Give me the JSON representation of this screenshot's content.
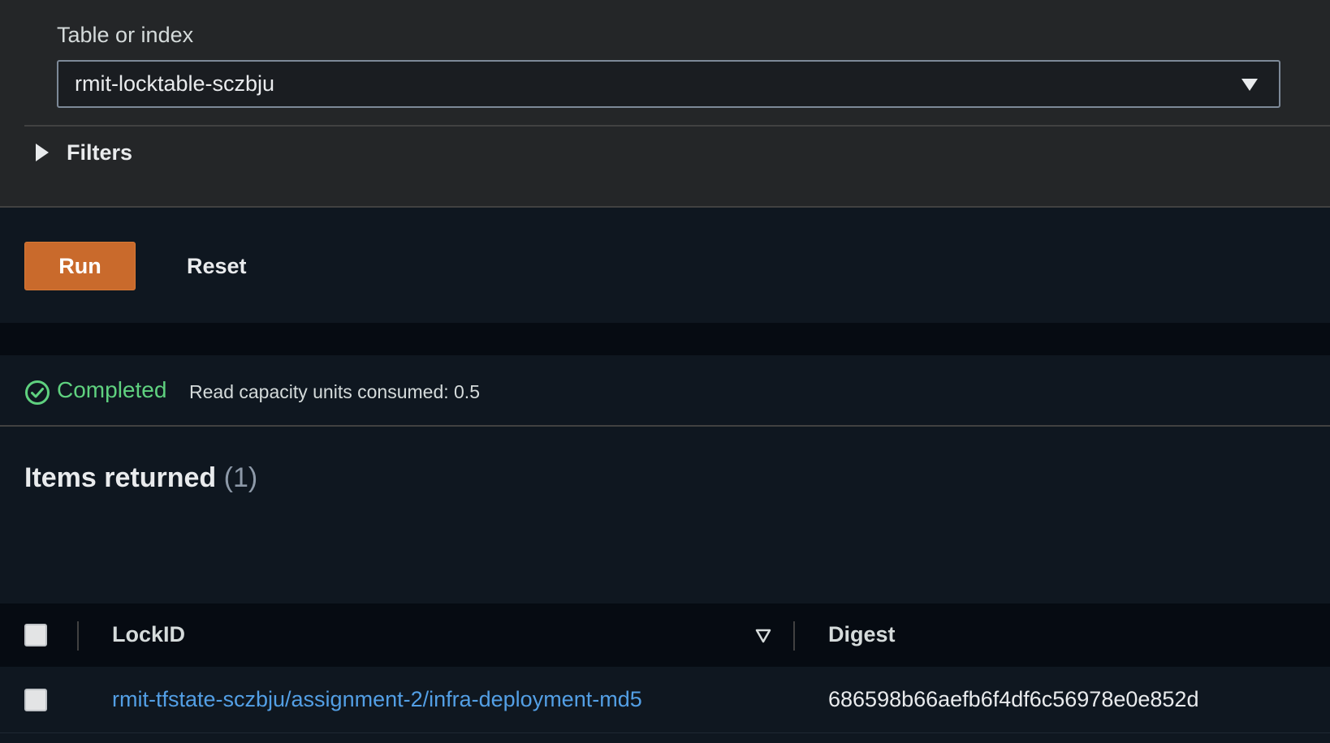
{
  "query_panel": {
    "table_label": "Table or index",
    "table_value": "rmit-locktable-sczbju",
    "filters_label": "Filters"
  },
  "actions": {
    "run_label": "Run",
    "reset_label": "Reset"
  },
  "status": {
    "text": "Completed",
    "capacity": "Read capacity units consumed: 0.5",
    "color": "#5fd17f"
  },
  "results": {
    "title": "Items returned",
    "count": "(1)",
    "columns": [
      "LockID",
      "Digest"
    ],
    "rows": [
      {
        "lock_id": "rmit-tfstate-sczbju/assignment-2/infra-deployment-md5",
        "digest": "686598b66aefb6f4df6c56978e0e852d"
      }
    ]
  },
  "colors": {
    "accent": "#c96a2c",
    "link": "#539fe5"
  },
  "icons": {
    "select_caret": "caret-down-icon",
    "filters_caret": "caret-right-icon",
    "status": "check-circle-icon",
    "sort": "sort-descending-icon"
  }
}
